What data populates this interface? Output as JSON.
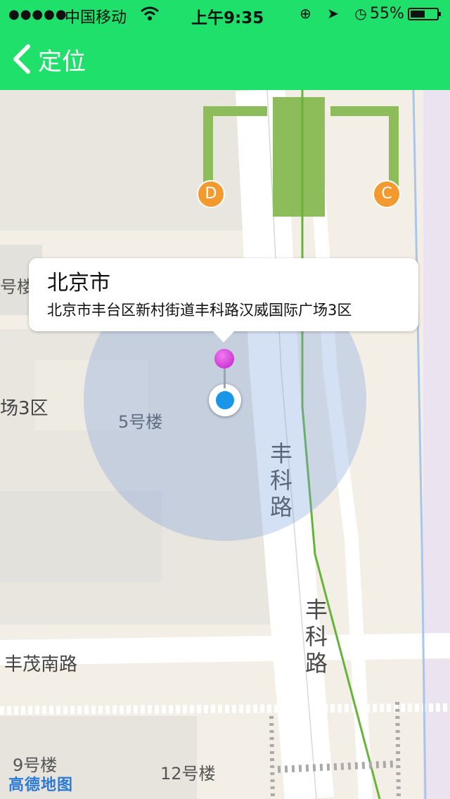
{
  "status_bar": {
    "signal": "●●●●●",
    "carrier": "中国移动",
    "wifi_icon": "wifi-icon",
    "time": "上午9:35",
    "icons": "⊕ ➤ ◷",
    "battery_pct": "55%",
    "battery_level": 0.55
  },
  "nav": {
    "back_icon": "chevron-left-icon",
    "title": "定位"
  },
  "map": {
    "labels": {
      "bldg_top_left": "号楼",
      "area_3": "场3区",
      "bldg_5": "5号楼",
      "road_east": "丰科路",
      "road_east_lower": "丰科路",
      "road_south": "丰茂南路",
      "bldg_9": "9号楼",
      "bldg_12": "12号楼"
    },
    "poi_d": "D",
    "poi_c": "C",
    "logo": "高德地图"
  },
  "callout": {
    "title": "北京市",
    "address": "北京市丰台区新村街道丰科路汉威国际广场3区"
  },
  "colors": {
    "accent": "#1ee06b",
    "map_bg": "#f3efe6",
    "location_blue": "#1a96e8",
    "pin_magenta": "#d22fd8",
    "poi_orange": "#f29a2e",
    "metro_green": "#8cbd5a"
  }
}
